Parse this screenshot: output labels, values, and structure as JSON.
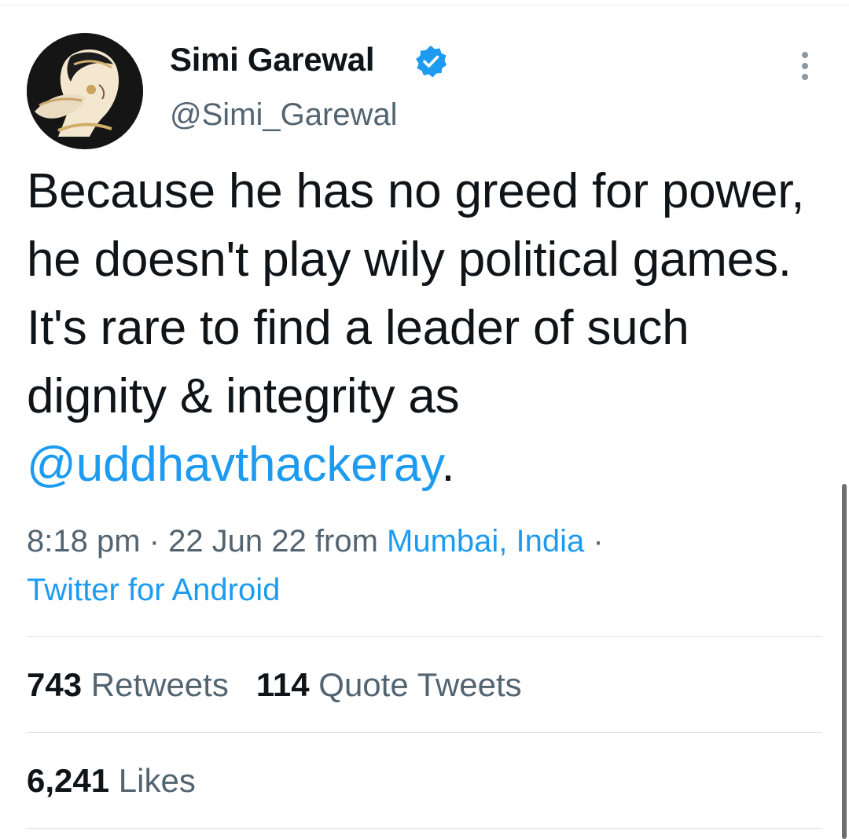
{
  "author": {
    "name": "Simi Garewal",
    "handle": "@Simi_Garewal",
    "verified": true
  },
  "tweet": {
    "text_before": "Because he has no greed for power, he doesn't play wily political games. It's rare to find a leader of such dignity & integrity as ",
    "mention": "@uddhavthackeray",
    "text_after": "."
  },
  "meta": {
    "time": "8:18 pm",
    "separator": " · ",
    "date": "22 Jun 22",
    "from_label": " from ",
    "location": "Mumbai, India",
    "separator2": " ·",
    "client": "Twitter for Android"
  },
  "stats": {
    "retweets_count": "743",
    "retweets_label": "Retweets",
    "quote_count": "114",
    "quote_label": "Quote Tweets",
    "likes_count": "6,241",
    "likes_label": "Likes"
  },
  "icons": {
    "verified": "verified-badge-icon",
    "more": "more-vertical-icon"
  },
  "colors": {
    "accent": "#1d9bf0",
    "text": "#0f1419",
    "secondary": "#536471",
    "divider": "#dfe3e6"
  }
}
